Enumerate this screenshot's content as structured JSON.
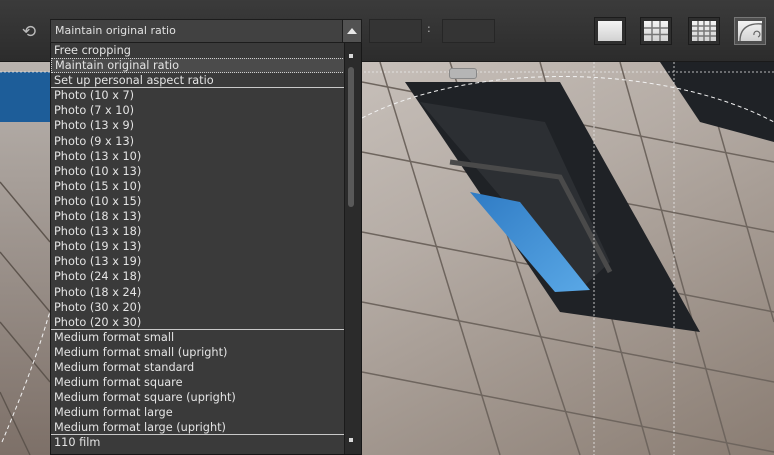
{
  "toolbar": {
    "rotate_icon": "rotate-arrows-icon",
    "ratio_select": {
      "value": "Maintain original ratio"
    },
    "width_value": "",
    "height_value": "",
    "separator": ":",
    "overlay_buttons": [
      {
        "icon": "no-grid-icon"
      },
      {
        "icon": "grid-3x3-icon"
      },
      {
        "icon": "grid-4x4-icon"
      },
      {
        "icon": "golden-spiral-icon"
      }
    ]
  },
  "dropdown": {
    "options": [
      "Free cropping",
      "Maintain original ratio",
      "Set up personal aspect ratio",
      "Photo (10 x 7)",
      "Photo (7 x 10)",
      "Photo (13 x 9)",
      "Photo (9 x 13)",
      "Photo (13 x 10)",
      "Photo (10 x 13)",
      "Photo (15 x 10)",
      "Photo (10 x 15)",
      "Photo (18 x 13)",
      "Photo (13 x 18)",
      "Photo (19 x 13)",
      "Photo (13 x 19)",
      "Photo (24 x 18)",
      "Photo (18 x 24)",
      "Photo (30 x 20)",
      "Photo (20 x 30)",
      "Medium format small",
      "Medium format small (upright)",
      "Medium format standard",
      "Medium format square",
      "Medium format square (upright)",
      "Medium format large",
      "Medium format large (upright)",
      "110 film"
    ],
    "selected_index": 1
  },
  "colors": {
    "toolbar": "#333333",
    "dropdown_bg": "#3a3a3a",
    "window_glass": "#3f8ed4"
  }
}
